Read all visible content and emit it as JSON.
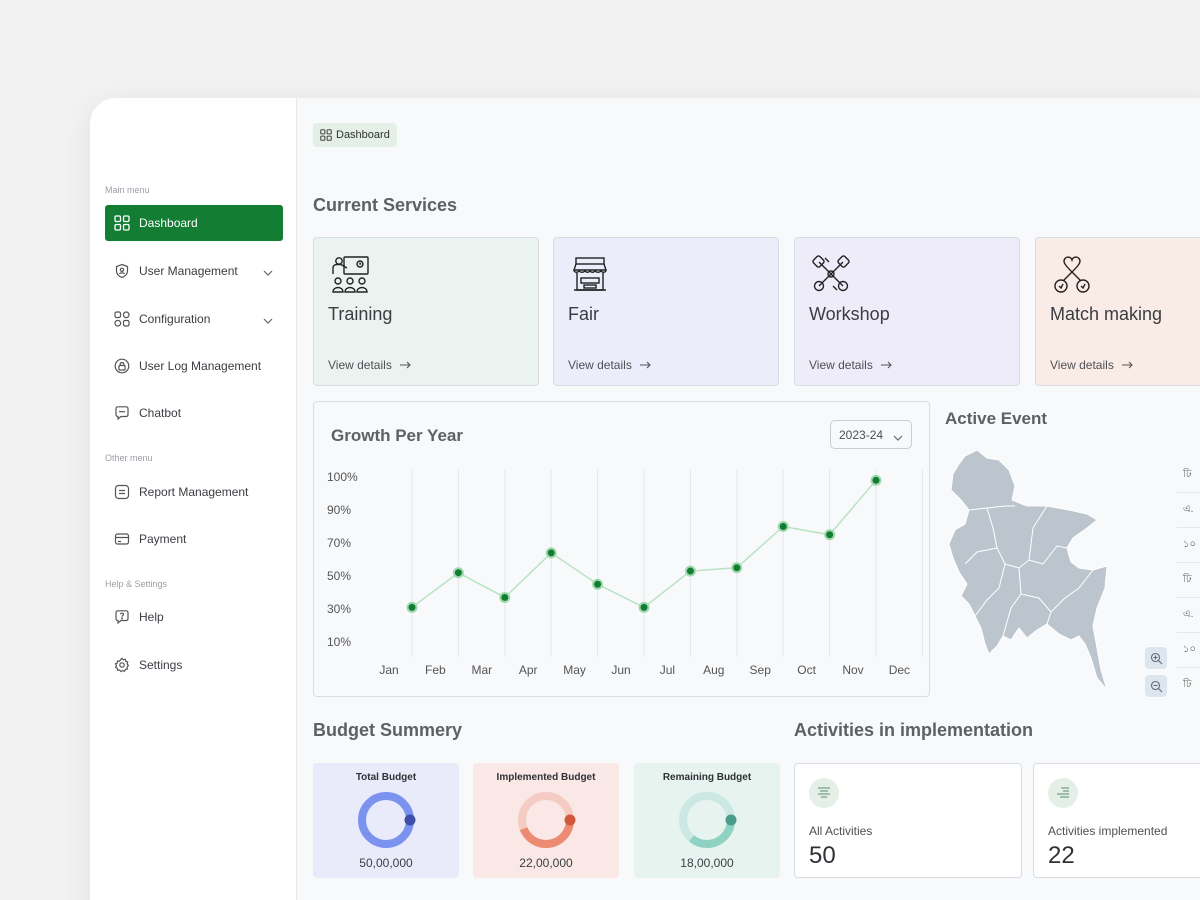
{
  "sidebar": {
    "main_heading": "Main menu",
    "other_heading": "Other menu",
    "help_heading": "Help & Settings",
    "items": [
      {
        "label": "Dashboard"
      },
      {
        "label": "User Management"
      },
      {
        "label": "Configuration"
      },
      {
        "label": "User Log Management"
      },
      {
        "label": "Chatbot"
      },
      {
        "label": "Report Management"
      },
      {
        "label": "Payment"
      },
      {
        "label": "Help"
      },
      {
        "label": "Settings"
      }
    ],
    "active_color": "#137d34"
  },
  "breadcrumb": {
    "label": "Dashboard"
  },
  "services": {
    "title": "Current Services",
    "cards": [
      {
        "name": "Training",
        "link": "View details",
        "icon": "training-icon",
        "bg": "#eaf3ef"
      },
      {
        "name": "Fair",
        "link": "View details",
        "icon": "stall-icon",
        "bg": "#ebedfa"
      },
      {
        "name": "Workshop",
        "link": "View details",
        "icon": "tools-icon",
        "bg": "#eeecf8"
      },
      {
        "name": "Match making",
        "link": "View details",
        "icon": "match-icon",
        "bg": "#f9ebe6"
      }
    ]
  },
  "growth": {
    "title": "Growth Per Year",
    "year": "2023-24"
  },
  "chart_data": {
    "type": "line",
    "title": "Growth Per Year",
    "categories": [
      "Jan",
      "Feb",
      "Mar",
      "Apr",
      "May",
      "Jun",
      "Jul",
      "Aug",
      "Sep",
      "Oct",
      "Nov",
      "Dec"
    ],
    "values": [
      31,
      52,
      37,
      64,
      45,
      31,
      53,
      55,
      80,
      75,
      99
    ],
    "ylim": [
      0,
      100
    ],
    "yticks": [
      "100%",
      "90%",
      "70%",
      "50%",
      "30%",
      "10%"
    ],
    "grid": "vertical",
    "line_color": "#b7e3c2",
    "point_color": "#137d34"
  },
  "event": {
    "title": "Active Event",
    "rows": [
      "ঢি",
      "এ.",
      "১০",
      "ঢি",
      "এ.",
      "১০",
      "ঢি"
    ]
  },
  "budget": {
    "title": "Budget Summery",
    "cards": [
      {
        "label": "Total Budget",
        "value": "50,00,000",
        "bg": "#e9ebfb",
        "ring": "#7b93ee",
        "knob": "#3f4fa8",
        "fraction": 1.0
      },
      {
        "label": "Implemented Budget",
        "value": "22,00,000",
        "bg": "#f9e8e5",
        "ring": "#ec8a74",
        "knob": "#d0573d",
        "fraction": 0.44
      },
      {
        "label": "Remaining Budget",
        "value": "18,00,000",
        "bg": "#e6f3ef",
        "ring": "#8fd1c2",
        "knob": "#4a9c8c",
        "fraction": 0.36
      }
    ]
  },
  "activities": {
    "title": "Activities in implementation",
    "cards": [
      {
        "label": "All Activities",
        "value": "50"
      },
      {
        "label": "Activities implemented",
        "value": "22"
      }
    ]
  }
}
